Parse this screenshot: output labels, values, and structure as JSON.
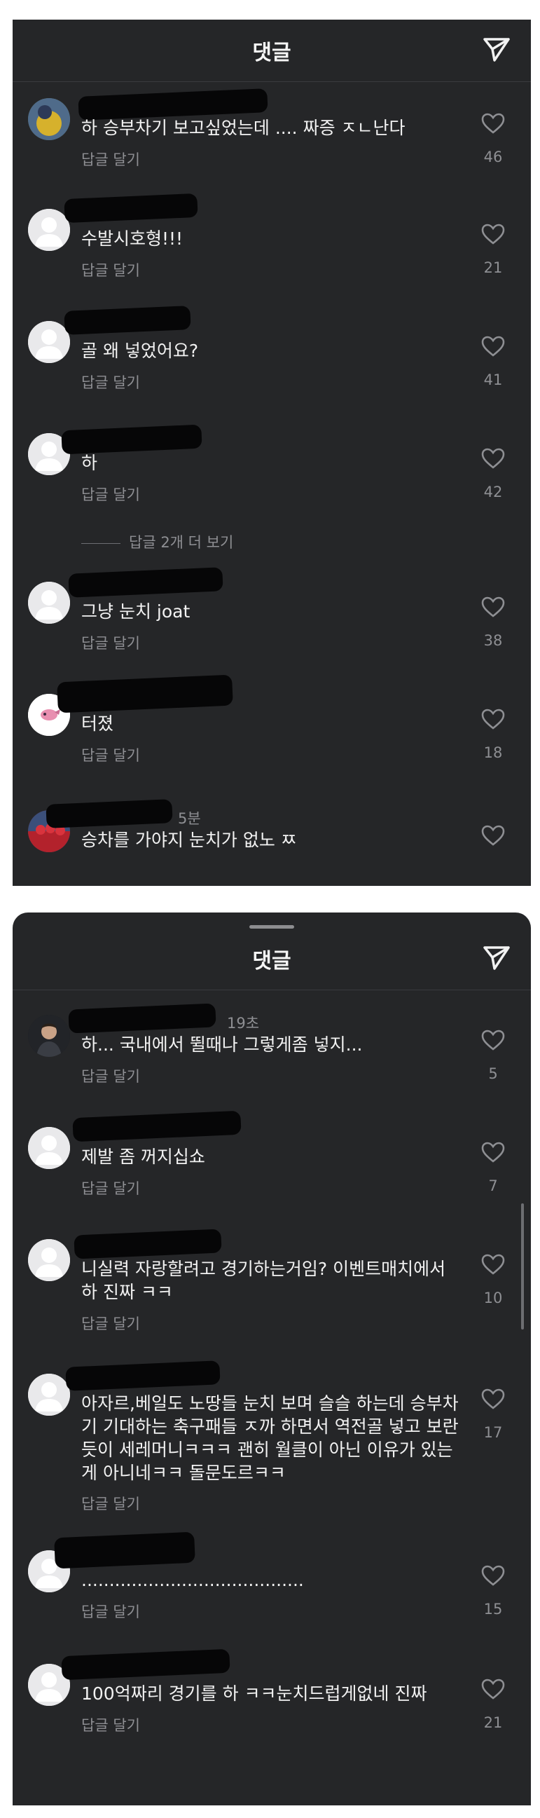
{
  "panel1": {
    "header_title": "댓글",
    "comments": [
      {
        "text": "하 승부차기 보고싶었는데 .... 짜증 ㅈㄴ난다",
        "reply": "답글 달기",
        "likes": "46"
      },
      {
        "text": "수발시호형!!!",
        "reply": "답글 달기",
        "likes": "21"
      },
      {
        "text": "골 왜 넣었어요?",
        "reply": "답글 달기",
        "likes": "41"
      },
      {
        "text": "하",
        "reply": "답글 달기",
        "likes": "42"
      },
      {
        "text": "그냥 눈치 joat",
        "reply": "답글 달기",
        "likes": "38"
      },
      {
        "text": "터졌",
        "reply": "답글 달기",
        "likes": "18"
      },
      {
        "meta": "5분",
        "text": "승차를 가야지 눈치가 없노 ㅉ"
      }
    ],
    "more_replies": "답글 2개 더 보기"
  },
  "panel2": {
    "header_title": "댓글",
    "comments": [
      {
        "meta": "19초",
        "text": "하... 국내에서 뛸때나 그렇게좀 넣지...",
        "reply": "답글 달기",
        "likes": "5"
      },
      {
        "text": "제발 좀 꺼지십쇼",
        "reply": "답글 달기",
        "likes": "7"
      },
      {
        "text": "니실력 자랑할려고 경기하는거임? 이벤트매치에서 하 진짜 ㅋㅋ",
        "reply": "답글 달기",
        "likes": "10"
      },
      {
        "text": "아자르,베일도 노땅들 눈치 보며 슬슬 하는데 승부차기 기대하는 축구패들 ㅈ까 하면서 역전골 넣고 보란듯이 세레머니ㅋㅋㅋ 괜히 월클이 아닌 이유가 있는게 아니네ㅋㅋ 돌문도르ㅋㅋ",
        "reply": "답글 달기",
        "likes": "17"
      },
      {
        "text": "........................................",
        "reply": "답글 달기",
        "likes": "15"
      },
      {
        "text": "100억짜리 경기를 하 ㅋㅋ눈치드럽게없네 진짜",
        "reply": "답글 달기",
        "likes": "21"
      }
    ]
  },
  "colors": {
    "background": "#252628",
    "text": "#f2f2f2",
    "muted": "#8e8f93",
    "redaction": "#060607"
  },
  "icons": {
    "send": "send-icon",
    "like": "heart-outline-icon",
    "avatar_placeholder": "user-silhouette-icon"
  }
}
